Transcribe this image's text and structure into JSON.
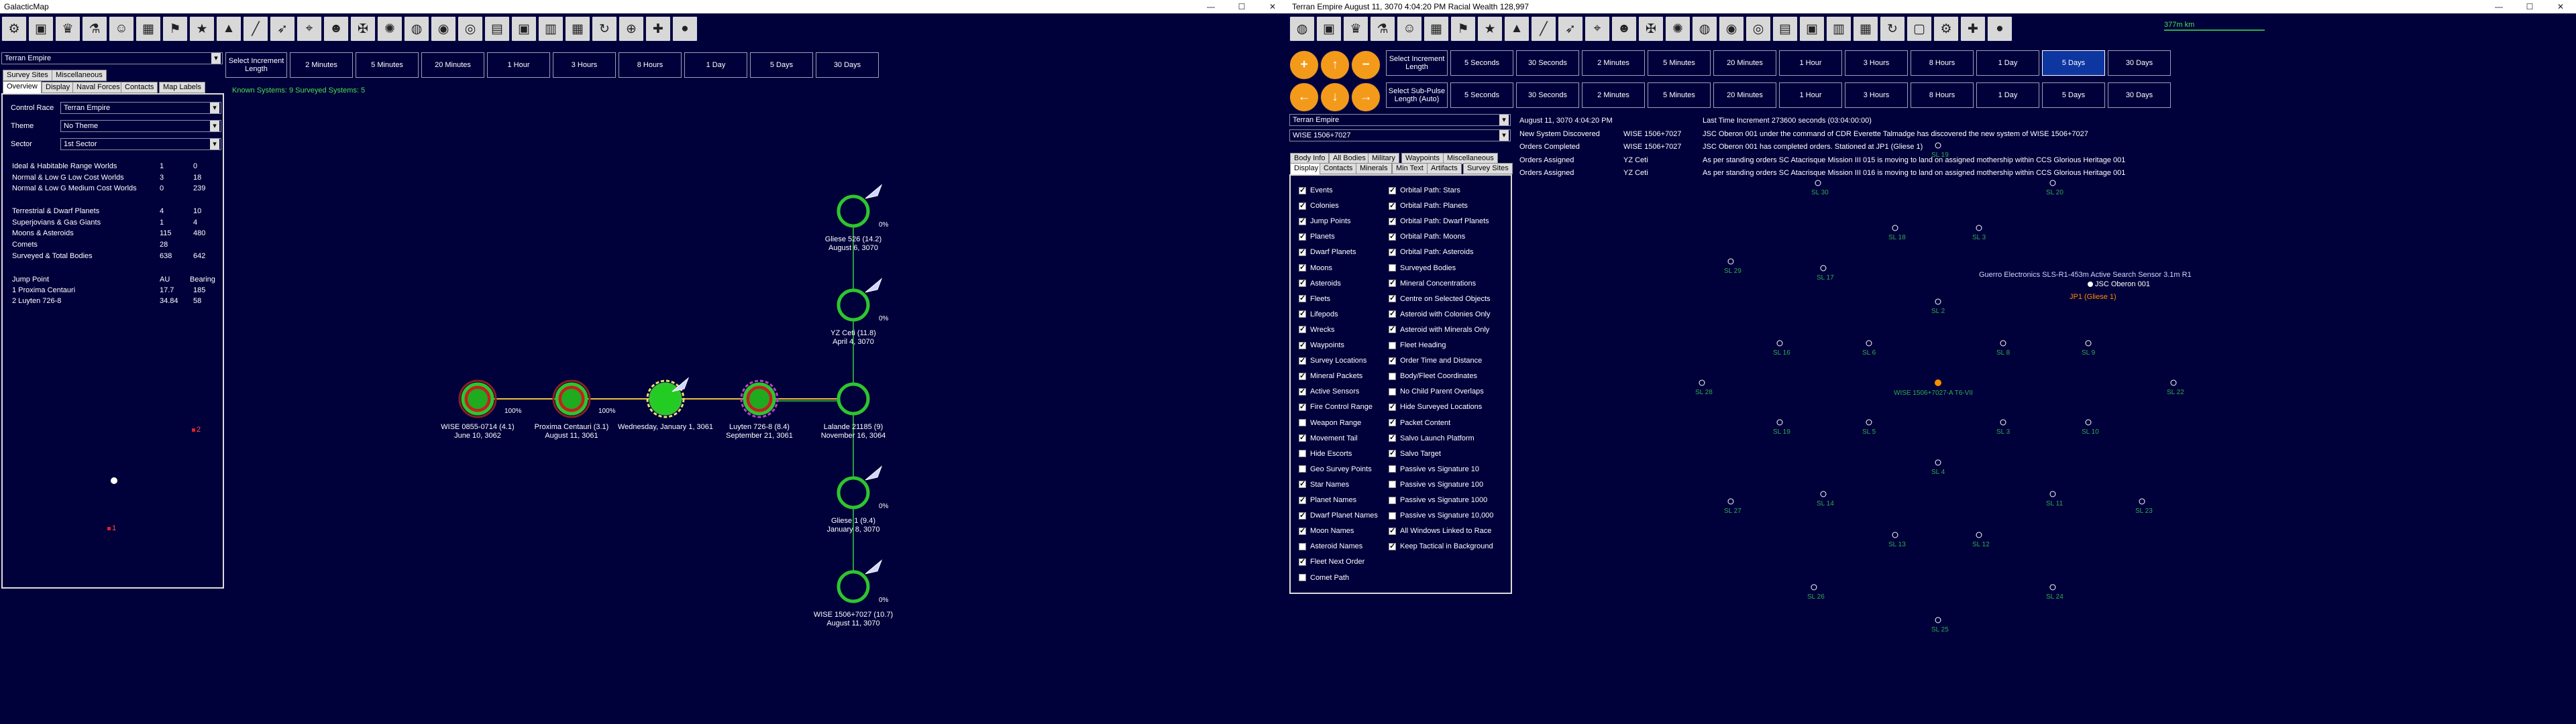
{
  "left": {
    "title": "GalacticMap",
    "win_min": "—",
    "win_max": "☐",
    "win_close": "✕",
    "toolbar_icons": [
      "gear-icon",
      "hierarchy-icon",
      "crown-icon",
      "flask-icon",
      "person-icon",
      "grid-icon",
      "flag-icon",
      "star-icon",
      "tank-icon",
      "gun-icon",
      "missile-icon",
      "telescope-icon",
      "portrait-icon",
      "union-flag-icon",
      "galaxy-icon",
      "earth-icon",
      "vortex-icon",
      "planet-icon",
      "circuit-icon",
      "chip-icon",
      "calendar-icon",
      "building-icon",
      "cycle-icon",
      "crosshair-icon",
      "plus-icon",
      "orb-icon"
    ],
    "toolbar_glyphs": [
      "⚙",
      "▣",
      "♛",
      "⚗",
      "☺",
      "▦",
      "⚑",
      "★",
      "▲",
      "╱",
      "➶",
      "⌖",
      "☻",
      "✠",
      "✺",
      "◍",
      "◉",
      "◎",
      "▤",
      "▣",
      "▥",
      "▦",
      "↻",
      "⊕",
      "✚",
      "●"
    ],
    "increment_label": "Select Increment Length",
    "time_buttons": [
      "2 Minutes",
      "5 Minutes",
      "20 Minutes",
      "1 Hour",
      "3 Hours",
      "8 Hours",
      "1 Day",
      "5 Days",
      "30 Days"
    ],
    "race_select": "Terran Empire",
    "tabs_top": [
      "Survey Sites",
      "Miscellaneous"
    ],
    "tabs_bottom": [
      "Overview",
      "Display",
      "Naval Forces",
      "Contacts",
      "Map Labels"
    ],
    "known_systems": "Known Systems: 9   Surveyed Systems: 5",
    "control_race_label": "Control Race",
    "control_race_value": "Terran Empire",
    "theme_label": "Theme",
    "theme_value": "No Theme",
    "sector_label": "Sector",
    "sector_value": "1st Sector",
    "stats": [
      {
        "label": "Ideal & Habitable Range Worlds",
        "a": "1",
        "b": "0"
      },
      {
        "label": "Normal & Low G Low Cost Worlds",
        "a": "3",
        "b": "18"
      },
      {
        "label": "Normal & Low G Medium Cost Worlds",
        "a": "0",
        "b": "239"
      },
      {
        "label": "",
        "a": "",
        "b": ""
      },
      {
        "label": "Terrestrial & Dwarf Planets",
        "a": "4",
        "b": "10"
      },
      {
        "label": "Superjovians & Gas Giants",
        "a": "1",
        "b": "4"
      },
      {
        "label": "Moons & Asteroids",
        "a": "115",
        "b": "480"
      },
      {
        "label": "Comets",
        "a": "28",
        "b": ""
      },
      {
        "label": "Surveyed & Total Bodies",
        "a": "638",
        "b": "642"
      }
    ],
    "jump_header": {
      "label": "Jump Point",
      "a": "AU",
      "b": "Bearing"
    },
    "jumps": [
      {
        "label": "1  Proxima Centauri",
        "a": "17.7",
        "b": "185"
      },
      {
        "label": "2  Luyten 726-8",
        "a": "34.84",
        "b": "58"
      }
    ],
    "systems": [
      {
        "name": "WISE 0855-0714  (4.1)",
        "date": "June 10, 3062"
      },
      {
        "name": "Proxima Centauri  (3.1)",
        "date": "August 11, 3061"
      },
      {
        "name": "Wednesday, January 1, 3061",
        "date": ""
      },
      {
        "name": "Luyten 726-8  (8.4)",
        "date": "September 21, 3061"
      },
      {
        "name": "Lalande 21185  (9)",
        "date": "November 16, 3064"
      },
      {
        "name": "Gliese 526  (14.2)",
        "date": "August 6, 3070"
      },
      {
        "name": "YZ Ceti  (11.8)",
        "date": "April 4, 3070"
      },
      {
        "name": "Gliese 1  (9.4)",
        "date": "January 8, 3070"
      },
      {
        "name": "WISE 1506+7027  (10.7)",
        "date": "August 11, 3070"
      }
    ],
    "pct": [
      "100%",
      "100%",
      "0%",
      "0%",
      "0%",
      "0%"
    ],
    "map_labels": [
      "2",
      "1"
    ]
  },
  "right": {
    "title": "Terran Empire    August 11, 3070 4:04:20 PM    Racial Wealth 128,997",
    "win_min": "—",
    "win_max": "☐",
    "win_close": "✕",
    "toolbar_icons": [
      "globe-icon",
      "hierarchy-icon",
      "crown-icon",
      "flask-icon",
      "person-icon",
      "grid-icon",
      "flag-icon",
      "star-icon",
      "tank-icon",
      "gun-icon",
      "missile-icon",
      "telescope-icon",
      "portrait-icon",
      "union-flag-icon",
      "galaxy-icon",
      "earth-icon",
      "vortex-icon",
      "planet-icon",
      "circuit-icon",
      "chip-icon",
      "calendar-icon",
      "building-icon",
      "cycle-icon",
      "window-icon",
      "gear-icon",
      "plus-icon",
      "orb-icon"
    ],
    "toolbar_glyphs": [
      "◍",
      "▣",
      "♛",
      "⚗",
      "☺",
      "▦",
      "⚑",
      "★",
      "▲",
      "╱",
      "➶",
      "⌖",
      "☻",
      "✠",
      "✺",
      "◍",
      "◉",
      "◎",
      "▤",
      "▣",
      "▥",
      "▦",
      "↻",
      "▢",
      "⚙",
      "✚",
      "●"
    ],
    "scale": "377m km",
    "nav1_icons": [
      "zoom-in-icon",
      "up-arrow-icon",
      "zoom-out-icon"
    ],
    "nav2_icons": [
      "left-arrow-icon",
      "down-arrow-icon",
      "right-arrow-icon"
    ],
    "nav1_glyphs": [
      "+",
      "↑",
      "−"
    ],
    "nav2_glyphs": [
      "←",
      "↓",
      "→"
    ],
    "increment_label": "Select Increment Length",
    "subpulse_label": "Select Sub-Pulse Length (Auto)",
    "time_buttons": [
      "5 Seconds",
      "30 Seconds",
      "2 Minutes",
      "5 Minutes",
      "20 Minutes",
      "1 Hour",
      "3 Hours",
      "8 Hours",
      "1 Day",
      "5 Days",
      "30 Days"
    ],
    "selected_time": "5 Days",
    "race_select": "Terran Empire",
    "system_select": "WISE 1506+7027",
    "tabs_row1": [
      "Body Info",
      "All Bodies",
      "Military",
      "Waypoints",
      "Miscellaneous"
    ],
    "tabs_row2": [
      "Display",
      "Contacts",
      "Minerals",
      "Min Text",
      "Artifacts",
      "Survey Sites"
    ],
    "opts_left": [
      {
        "t": "Events",
        "on": true
      },
      {
        "t": "Colonies",
        "on": true
      },
      {
        "t": "Jump Points",
        "on": true
      },
      {
        "t": "Planets",
        "on": true
      },
      {
        "t": "Dwarf Planets",
        "on": true
      },
      {
        "t": "Moons",
        "on": true
      },
      {
        "t": "Asteroids",
        "on": true
      },
      {
        "t": "Fleets",
        "on": true
      },
      {
        "t": "Lifepods",
        "on": true
      },
      {
        "t": "Wrecks",
        "on": true
      },
      {
        "t": "Waypoints",
        "on": true
      },
      {
        "t": "Survey Locations",
        "on": true
      },
      {
        "t": "Mineral Packets",
        "on": true
      },
      {
        "t": "Active Sensors",
        "on": true
      },
      {
        "t": "Fire Control Range",
        "on": true
      },
      {
        "t": "Weapon Range",
        "on": false
      },
      {
        "t": "Movement Tail",
        "on": true
      },
      {
        "t": "Hide Escorts",
        "on": false
      },
      {
        "t": "Geo Survey Points",
        "on": false
      },
      {
        "t": "Star Names",
        "on": true
      },
      {
        "t": "Planet Names",
        "on": true
      },
      {
        "t": "Dwarf Planet Names",
        "on": true
      },
      {
        "t": "Moon Names",
        "on": true
      },
      {
        "t": "Asteroid Names",
        "on": false
      },
      {
        "t": "Fleet Next Order",
        "on": true
      },
      {
        "t": "Comet Path",
        "on": false
      }
    ],
    "opts_right": [
      {
        "t": "Orbital Path: Stars",
        "on": true
      },
      {
        "t": "Orbital Path: Planets",
        "on": true
      },
      {
        "t": "Orbital Path: Dwarf Planets",
        "on": true
      },
      {
        "t": "Orbital Path: Moons",
        "on": true
      },
      {
        "t": "Orbital Path: Asteroids",
        "on": true
      },
      {
        "t": "Surveyed Bodies",
        "on": false
      },
      {
        "t": "Mineral Concentrations",
        "on": true
      },
      {
        "t": "Centre on Selected Objects",
        "on": true
      },
      {
        "t": "Asteroid with Colonies Only",
        "on": true
      },
      {
        "t": "Asteroid with Minerals Only",
        "on": true
      },
      {
        "t": "Fleet Heading",
        "on": false
      },
      {
        "t": "Order Time and Distance",
        "on": true
      },
      {
        "t": "Body/Fleet Coordinates",
        "on": false
      },
      {
        "t": "No Child Parent Overlaps",
        "on": false
      },
      {
        "t": "Hide Surveyed Locations",
        "on": true
      },
      {
        "t": "Packet Content",
        "on": true
      },
      {
        "t": "Salvo Launch Platform",
        "on": true
      },
      {
        "t": "Salvo Target",
        "on": true
      },
      {
        "t": "Passive vs Signature 10",
        "on": false
      },
      {
        "t": "Passive vs Signature 100",
        "on": false
      },
      {
        "t": "Passive vs Signature 1000",
        "on": false
      },
      {
        "t": "Passive vs Signature 10,000",
        "on": false
      },
      {
        "t": "All Windows Linked to Race",
        "on": true
      },
      {
        "t": "Keep Tactical in Background",
        "on": true
      }
    ],
    "events": [
      {
        "c1": "August 11, 3070 4:04:20 PM",
        "c2": "",
        "c3": "Last Time Increment 273600 seconds  (03:04:00:00)"
      },
      {
        "c1": "New System Discovered",
        "c2": "WISE 1506+7027",
        "c3": "JSC Oberon 001 under the command of CDR Everette Talmadge has discovered the new system of WISE 1506+7027"
      },
      {
        "c1": "Orders Completed",
        "c2": "WISE 1506+7027",
        "c3": "JSC Oberon 001 has completed orders. Stationed at JP1 (Gliese 1)"
      },
      {
        "c1": "Orders Assigned",
        "c2": "YZ Ceti",
        "c3": "As per standing orders SC Atacrisque Mission III 015 is moving to land on assigned mothership within CCS Glorious Heritage 001"
      },
      {
        "c1": "Orders Assigned",
        "c2": "YZ Ceti",
        "c3": "As per standing orders SC Atacrisque Mission III 016 is moving to land on assigned mothership within CCS Glorious Heritage 001"
      }
    ],
    "sl_labels": [
      "SL 19",
      "SL 30",
      "SL 20",
      "SL 18",
      "SL 3",
      "SL 29",
      "SL 17",
      "SL 2",
      "SL 1",
      "SL 16",
      "SL 6",
      "SL 8",
      "SL 9",
      "SL 28",
      "SL 22",
      "SL 19",
      "SL 5",
      "SL 3",
      "SL 10",
      "SL 4",
      "SL 27",
      "SL 14",
      "SL 11",
      "SL 23",
      "SL 13",
      "SL 12",
      "SL 26",
      "SL 24",
      "SL 25"
    ],
    "sensor_text": "Guerro Electronics SLS-R1-453m Active Search Sensor  3.1m  R1",
    "ship_label": "JSC Oberon 001",
    "jp_label": "JP1  (Gliese 1)",
    "star_label": "WISE 1506+7027-A T6-VII",
    "colors": {
      "bg": "#00003a",
      "sl": "#2faa4f",
      "jump": "#ff8c00",
      "panel": "#dcdcdc"
    }
  }
}
